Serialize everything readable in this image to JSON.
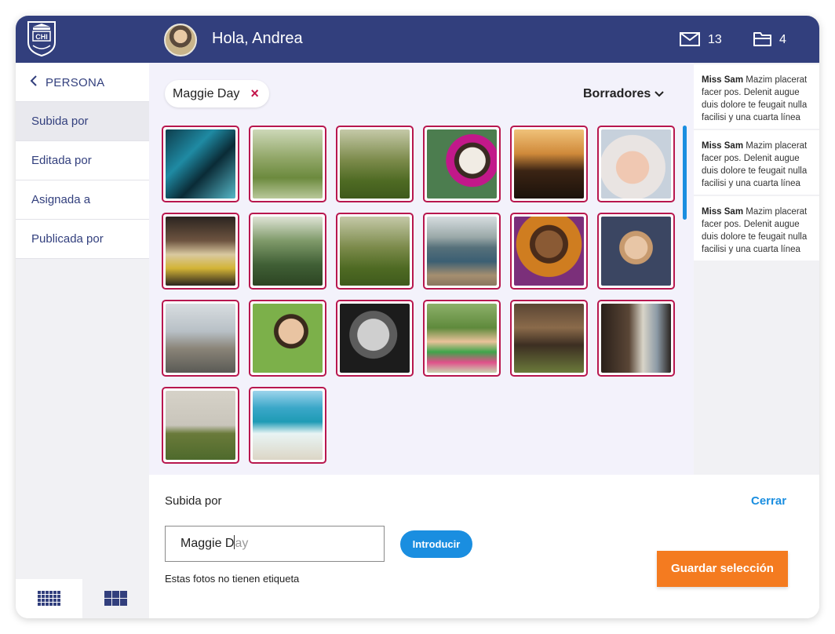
{
  "header": {
    "greeting": "Hola, Andrea",
    "logo_text": "CHI",
    "mail_count": "13",
    "folder_count": "4",
    "bg_color": "#323f7d"
  },
  "sidebar": {
    "back_label": "PERSONA",
    "items": [
      {
        "label": "Subida por",
        "active": true
      },
      {
        "label": "Editada por"
      },
      {
        "label": "Asignada a"
      },
      {
        "label": "Publicada por"
      }
    ]
  },
  "filter": {
    "chip_label": "Maggie Day",
    "chip_remove": "×",
    "dropdown_label": "Borradores"
  },
  "photos": [
    {
      "description": "child in aquarium blue"
    },
    {
      "description": "girl in tutu running on grass"
    },
    {
      "description": "girl in white dress in field"
    },
    {
      "description": "child with sugar-skull face paint"
    },
    {
      "description": "silhouettes at sunset on balcony"
    },
    {
      "description": "newborn baby crying"
    },
    {
      "description": "girl with striped sweater and yellow bag"
    },
    {
      "description": "mother carrying baby in garden"
    },
    {
      "description": "girl in white dress in field"
    },
    {
      "description": "person on pier by lake"
    },
    {
      "description": "smiling girl with bindi"
    },
    {
      "description": "toddler eating"
    },
    {
      "description": "kids with bicycle on railing"
    },
    {
      "description": "toddler in green bushes"
    },
    {
      "description": "baby black and white portrait"
    },
    {
      "description": "boys playing on grass"
    },
    {
      "description": "boy jumping by wooden house"
    },
    {
      "description": "child by window in dark room"
    },
    {
      "description": "woman in field"
    },
    {
      "description": "child at beach shore"
    }
  ],
  "comments": [
    {
      "author": "Miss Sam",
      "text": "Mazim placerat facer pos. Delenit augue duis dolore te feugait nulla facilisi y una cuarta línea"
    },
    {
      "author": "Miss Sam",
      "text": "Mazim placerat facer pos. Delenit augue duis dolore te feugait nulla facilisi y una cuarta línea"
    },
    {
      "author": "Miss Sam",
      "text": "Mazim placerat facer pos. Delenit augue duis dolore te feugait nulla facilisi y una cuarta línea"
    }
  ],
  "bottom": {
    "title": "Subida por",
    "close_label": "Cerrar",
    "input_typed": "Maggie D",
    "input_suggestion": "ay",
    "enter_label": "Introducir",
    "note": "Estas fotos no tienen etiqueta",
    "save_label": "Guardar selección"
  },
  "colors": {
    "accent_blue": "#1a8ee0",
    "tile_border": "#b8174e",
    "save_orange": "#f47b20"
  }
}
